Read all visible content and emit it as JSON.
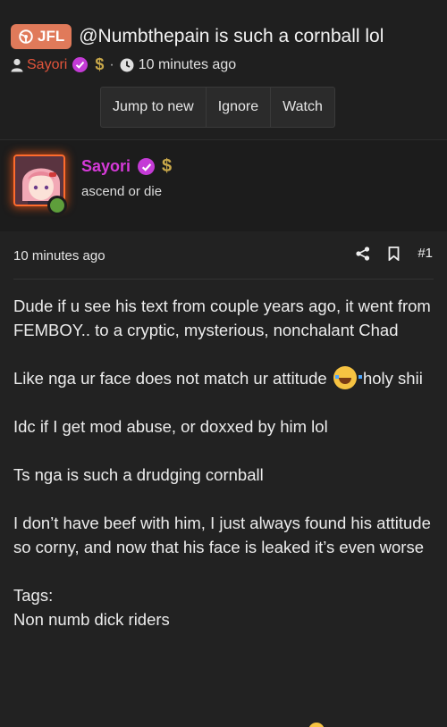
{
  "thread": {
    "prefix_label": "JFL",
    "title": "@Numbthepain is such a cornball lol",
    "author": "Sayori",
    "time_ago": "10 minutes ago",
    "separator": "·"
  },
  "actions": {
    "jump_label": "Jump to new",
    "ignore_label": "Ignore",
    "watch_label": "Watch"
  },
  "user": {
    "name": "Sayori",
    "title": "ascend or die",
    "online": true
  },
  "post": {
    "time_ago": "10 minutes ago",
    "number": "#1",
    "paragraphs": [
      "Dude if u see his text from couple years ago, it went from FEMBOY.. to a cryptic, mysterious, nonchalant Chad",
      "Idc if I get mod abuse, or doxxed by him lol",
      "Ts nga is such a drudging cornball",
      "I don’t have beef with him, I just always found his attitude so corny, and now that his face is leaked it’s even worse"
    ],
    "emoji_line_before": "Like nga ur face does not match ur attitude",
    "emoji_line_after": "holy shii",
    "tags_label": "Tags:",
    "tags_value": "Non numb dick riders"
  },
  "icons": {
    "prefix": "steering-wheel-icon",
    "user": "user-icon",
    "verified": "check-badge-icon",
    "supporter": "dollar-icon",
    "clock": "clock-icon",
    "share": "share-icon",
    "bookmark": "bookmark-icon",
    "emoji": "tears-of-joy-emoji"
  },
  "colors": {
    "prefix_bg": "#e07a5a",
    "author_link": "#e2543b",
    "username": "#d63ad9",
    "verified_badge": "#c43bd6",
    "supporter": "#c9a84a",
    "online": "#5e9e3b"
  }
}
